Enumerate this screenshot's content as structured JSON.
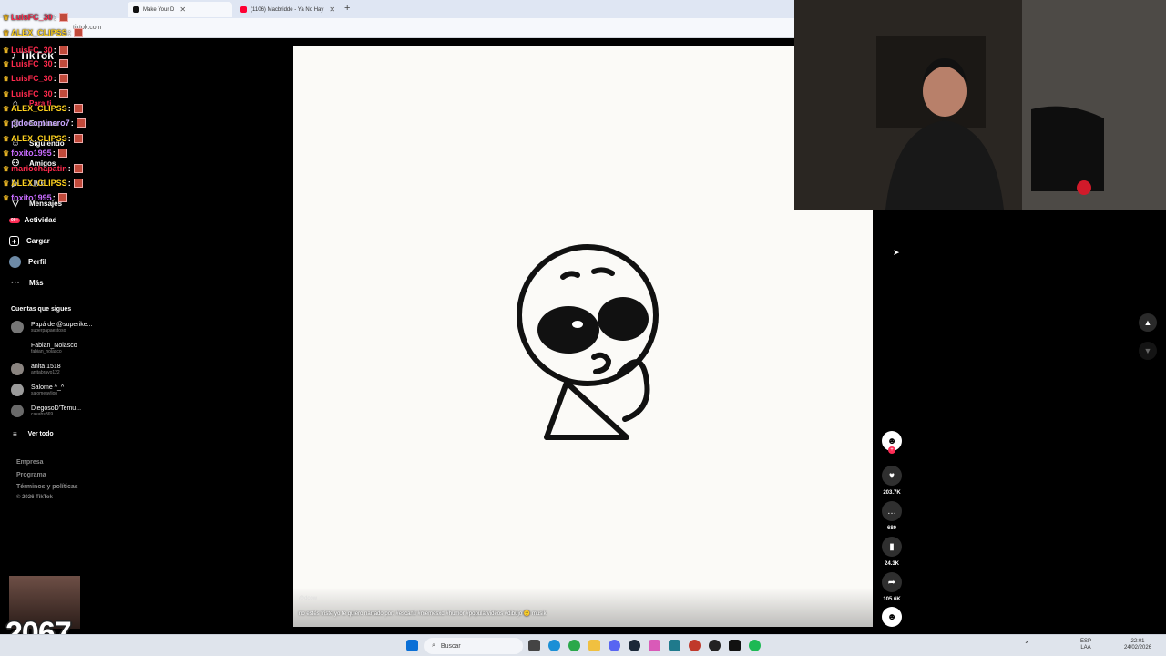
{
  "browser": {
    "tabs": [
      {
        "label": "Make Your D",
        "active": true
      },
      {
        "label": "(1106) Macbridde - Ya No Hay",
        "active": false
      }
    ],
    "new_tab": "+",
    "url": "tiktok.com"
  },
  "sidebar": {
    "logo": "TikTok",
    "nav": [
      {
        "label": "Para ti",
        "icon": "home-icon"
      },
      {
        "label": "Explorar",
        "icon": "compass-icon"
      },
      {
        "label": "Siguiendo",
        "icon": "following-icon"
      },
      {
        "label": "Amigos",
        "icon": "friends-icon"
      },
      {
        "label": "LIVE",
        "icon": "live-icon"
      },
      {
        "label": "Mensajes",
        "icon": "messages-icon",
        "badge": "1"
      },
      {
        "label": "Actividad",
        "icon": "activity-icon",
        "badge": "99+"
      },
      {
        "label": "Cargar",
        "icon": "upload-icon"
      },
      {
        "label": "Perfil",
        "icon": "profile-icon"
      },
      {
        "label": "Más",
        "icon": "more-icon"
      }
    ],
    "following_title": "Cuentas que sigues",
    "following": [
      {
        "name": "Papá de @superike...",
        "handle": "superpapaestoso"
      },
      {
        "name": "Fabian_Nolasco",
        "handle": "fabian_nolasco"
      },
      {
        "name": "anita 1518",
        "handle": "anitabravo122"
      },
      {
        "name": "Salome ^_^",
        "handle": "salomeaylion"
      },
      {
        "name": "DiegosoD'Temu...",
        "handle": "casabs869"
      }
    ],
    "see_all": "Ver todo",
    "footer": [
      "Empresa",
      "Programa",
      "Términos y políticas",
      "© 2026 TikTok"
    ]
  },
  "chat": [
    {
      "user": "LuisFC_30",
      "color": "#ff2a4d"
    },
    {
      "user": "ALEX_CLIPSS",
      "color": "#ffd21f"
    },
    {
      "user": "LuisFC_30",
      "color": "#ff2a4d"
    },
    {
      "user": "LuisFC_30",
      "color": "#ff2a4d"
    },
    {
      "user": "LuisFC_30",
      "color": "#ff2a4d"
    },
    {
      "user": "LuisFC_30",
      "color": "#ff2a4d"
    },
    {
      "user": "ALEX_CLIPSS",
      "color": "#ffd21f"
    },
    {
      "user": "pidocominero7",
      "color": "#c9a6ff"
    },
    {
      "user": "ALEX_CLIPSS",
      "color": "#ffd21f"
    },
    {
      "user": "foxito1995",
      "color": "#c86bff"
    },
    {
      "user": "mariochapatin",
      "color": "#ff2a4d"
    },
    {
      "user": "ALEX_CLIPSS",
      "color": "#ffd21f"
    },
    {
      "user": "foxito1995",
      "color": "#c86bff"
    }
  ],
  "video": {
    "author": "@dcow",
    "caption": "no estés triste yo te quiero narrado por: #escanti #memesxd #humor #popularvideos #dibujo 🙂 musik"
  },
  "actions": [
    {
      "name": "like",
      "icon": "heart-icon",
      "count": "203.7K"
    },
    {
      "name": "comment",
      "icon": "comment-icon",
      "count": "680"
    },
    {
      "name": "save",
      "icon": "bookmark-icon",
      "count": "24.3K"
    },
    {
      "name": "share",
      "icon": "share-icon",
      "count": "105.6K"
    }
  ],
  "viewer_count": "2067",
  "taskbar": {
    "search": "Buscar",
    "lang": "ESP",
    "lang2": "LAA",
    "time": "22:01",
    "date": "24/02/2026"
  }
}
